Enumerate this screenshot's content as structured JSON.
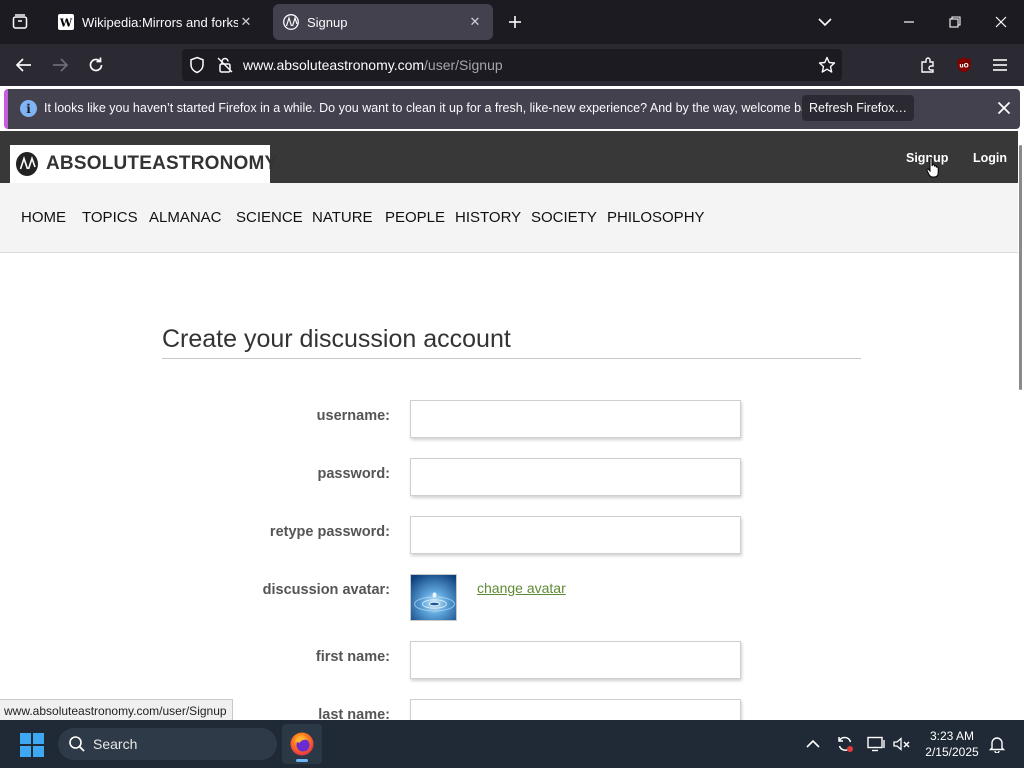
{
  "browser": {
    "tabs": [
      {
        "title": "Wikipedia:Mirrors and forks/All",
        "active": false
      },
      {
        "title": "Signup",
        "active": true
      }
    ],
    "url": {
      "host": "www.absoluteastronomy.com",
      "path": "/user/Signup"
    },
    "notification": {
      "text": "It looks like you haven’t started Firefox in a while. Do you want to clean it up for a fresh, like-new experience? And by the way, welcome back!",
      "button": "Refresh Firefox…"
    },
    "status_url": "www.absoluteastronomy.com/user/Signup",
    "icons": [
      "tab-list-icon",
      "wikipedia-favicon",
      "absoluteastronomy-favicon",
      "close-icon",
      "plus-icon",
      "chevron-down-icon",
      "minimize-icon",
      "restore-icon",
      "back-arrow-icon",
      "forward-arrow-icon",
      "reload-icon",
      "shield-icon",
      "lock-broken-icon",
      "star-icon",
      "extensions-icon",
      "ublock-icon",
      "hamburger-menu-icon",
      "info-icon"
    ]
  },
  "site": {
    "logo_text": "ABSOLUTEASTRONOMY",
    "top_links": {
      "signup": "Signup",
      "login": "Login"
    },
    "menu": [
      "HOME",
      "TOPICS",
      "ALMANAC",
      "SCIENCE",
      "NATURE",
      "PEOPLE",
      "HISTORY",
      "SOCIETY",
      "PHILOSOPHY"
    ]
  },
  "form": {
    "title": "Create your discussion account",
    "fields": {
      "username": {
        "label": "username:",
        "value": ""
      },
      "password": {
        "label": "password:",
        "value": ""
      },
      "retype_password": {
        "label": "retype password:",
        "value": ""
      },
      "avatar": {
        "label": "discussion avatar:",
        "link": "change avatar"
      },
      "first_name": {
        "label": "first name:",
        "value": ""
      },
      "last_name": {
        "label": "last name:",
        "value": ""
      }
    }
  },
  "taskbar": {
    "search_placeholder": "Search",
    "time": "3:23 AM",
    "date": "2/15/2025"
  }
}
